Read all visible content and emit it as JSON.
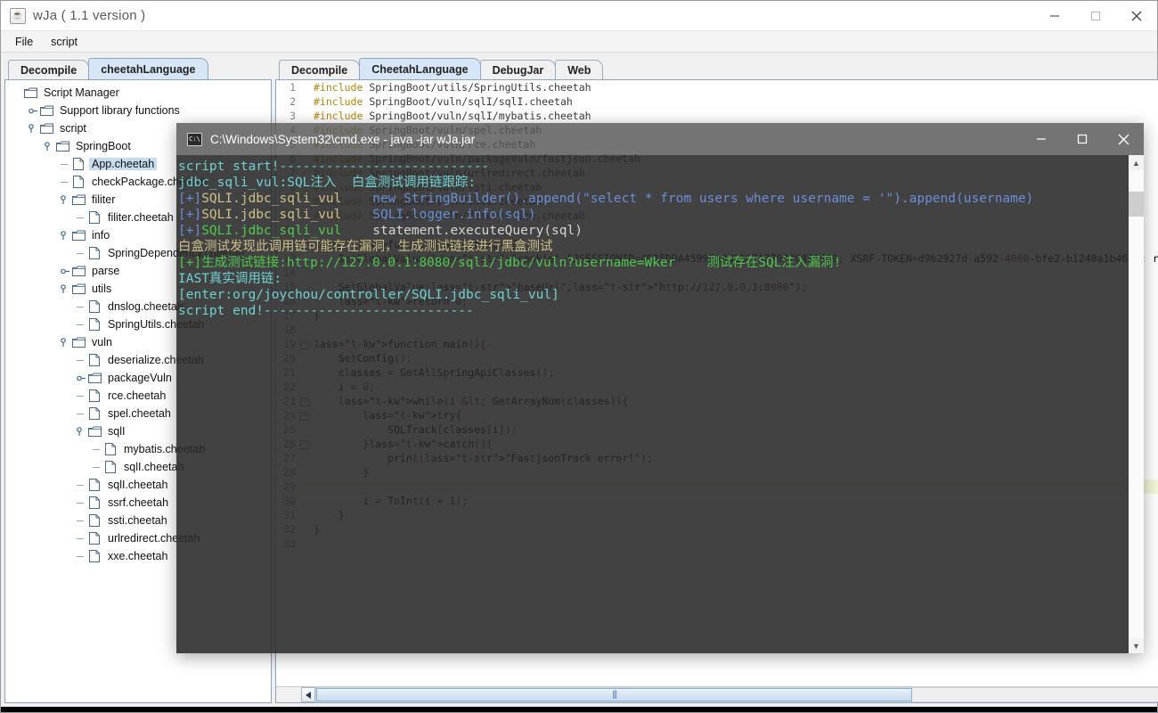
{
  "window": {
    "title": "wJa ( 1.1 version )",
    "icon": "java-icon",
    "minimize": "minimize-icon",
    "maximize": "maximize-icon",
    "close": "close-icon"
  },
  "menu": {
    "items": [
      "File",
      "script"
    ]
  },
  "left": {
    "tabs": [
      {
        "label": "Decompile",
        "selected": false
      },
      {
        "label": "cheetahLanguage",
        "selected": true
      }
    ],
    "tree": [
      {
        "label": "Script Manager",
        "depth": 0,
        "type": "folder",
        "handle": "none",
        "selected": false
      },
      {
        "label": "Support library functions",
        "depth": 1,
        "type": "folder",
        "handle": "collapsed",
        "selected": false
      },
      {
        "label": "script",
        "depth": 1,
        "type": "folder",
        "handle": "expanded",
        "selected": false
      },
      {
        "label": "SpringBoot",
        "depth": 2,
        "type": "folder",
        "handle": "expanded",
        "selected": false
      },
      {
        "label": "App.cheetah",
        "depth": 3,
        "type": "file",
        "handle": "leaf",
        "selected": true
      },
      {
        "label": "checkPackage.cheetah",
        "depth": 3,
        "type": "file",
        "handle": "leaf",
        "selected": false
      },
      {
        "label": "filiter",
        "depth": 3,
        "type": "folder",
        "handle": "expanded",
        "selected": false
      },
      {
        "label": "filiter.cheetah",
        "depth": 4,
        "type": "file",
        "handle": "leaf",
        "selected": false
      },
      {
        "label": "info",
        "depth": 3,
        "type": "folder",
        "handle": "expanded",
        "selected": false
      },
      {
        "label": "SpringDependency.cheetah",
        "depth": 4,
        "type": "file",
        "handle": "leaf",
        "selected": false
      },
      {
        "label": "parse",
        "depth": 3,
        "type": "folder",
        "handle": "collapsed",
        "selected": false
      },
      {
        "label": "utils",
        "depth": 3,
        "type": "folder",
        "handle": "expanded",
        "selected": false
      },
      {
        "label": "dnslog.cheetah",
        "depth": 4,
        "type": "file",
        "handle": "leaf",
        "selected": false
      },
      {
        "label": "SpringUtils.cheetah",
        "depth": 4,
        "type": "file",
        "handle": "leaf",
        "selected": false
      },
      {
        "label": "vuln",
        "depth": 3,
        "type": "folder",
        "handle": "expanded",
        "selected": false
      },
      {
        "label": "deserialize.cheetah",
        "depth": 4,
        "type": "file",
        "handle": "leaf",
        "selected": false
      },
      {
        "label": "packageVuln",
        "depth": 4,
        "type": "folder",
        "handle": "collapsed",
        "selected": false
      },
      {
        "label": "rce.cheetah",
        "depth": 4,
        "type": "file",
        "handle": "leaf",
        "selected": false
      },
      {
        "label": "spel.cheetah",
        "depth": 4,
        "type": "file",
        "handle": "leaf",
        "selected": false
      },
      {
        "label": "sqlI",
        "depth": 4,
        "type": "folder",
        "handle": "expanded",
        "selected": false
      },
      {
        "label": "mybatis.cheetah",
        "depth": 5,
        "type": "file",
        "handle": "leaf",
        "selected": false
      },
      {
        "label": "sqlI.cheetah",
        "depth": 5,
        "type": "file",
        "handle": "leaf",
        "selected": false
      },
      {
        "label": "sqlI.cheetah",
        "depth": 4,
        "type": "file",
        "handle": "leaf",
        "selected": false
      },
      {
        "label": "ssrf.cheetah",
        "depth": 4,
        "type": "file",
        "handle": "leaf",
        "selected": false
      },
      {
        "label": "ssti.cheetah",
        "depth": 4,
        "type": "file",
        "handle": "leaf",
        "selected": false
      },
      {
        "label": "urlredirect.cheetah",
        "depth": 4,
        "type": "file",
        "handle": "leaf",
        "selected": false
      },
      {
        "label": "xxe.cheetah",
        "depth": 4,
        "type": "file",
        "handle": "leaf",
        "selected": false
      }
    ]
  },
  "right": {
    "tabs": [
      {
        "label": "Decompile",
        "selected": false
      },
      {
        "label": "CheetahLanguage",
        "selected": true
      },
      {
        "label": "DebugJar",
        "selected": false
      },
      {
        "label": "Web",
        "selected": false
      }
    ],
    "code": [
      {
        "n": 1,
        "fold": "",
        "text": "#include SpringBoot/utils/SpringUtils.cheetah"
      },
      {
        "n": 2,
        "fold": "",
        "text": "#include SpringBoot/vuln/sqlI/sqlI.cheetah"
      },
      {
        "n": 3,
        "fold": "",
        "text": "#include SpringBoot/vuln/sqlI/mybatis.cheetah"
      },
      {
        "n": 4,
        "fold": "",
        "text": "#include SpringBoot/vuln/spel.cheetah"
      },
      {
        "n": 5,
        "fold": "",
        "text": "#include SpringBoot/vuln/rce.cheetah"
      },
      {
        "n": 6,
        "fold": "",
        "text": "#include SpringBoot/vuln/packageVuln/fastjson.cheetah"
      },
      {
        "n": 7,
        "fold": "",
        "text": "#include SpringBoot/vuln/urlredirect.cheetah"
      },
      {
        "n": 8,
        "fold": "",
        "text": "#include SpringBoot/vuln/ssti.cheetah"
      },
      {
        "n": 9,
        "fold": "",
        "text": "#include SpringBoot/vuln/ssti.cheetah"
      },
      {
        "n": 10,
        "fold": "",
        "text": "#include SpringBoot/vuln/deserialize.cheetah"
      },
      {
        "n": 11,
        "fold": "",
        "text": ""
      },
      {
        "n": 12,
        "fold": "-",
        "text": "function SetConfig(){"
      },
      {
        "n": 13,
        "fold": "",
        "text": "    SetGlobalValue(\"cookie\",\"JSESSIONID=4D15DDA4599EA9B23C7177022C481469; XSRF-TOKEN=d9b2927d-a592-4060-bfe2-b1240a1b46f4; remember-me"
      },
      {
        "n": 14,
        "fold": "",
        "text": ""
      },
      {
        "n": 15,
        "fold": "",
        "text": "    SetGlobalValue(\"baseUrl\",\"http://127.0.0.1:8080\");"
      },
      {
        "n": 16,
        "fold": "",
        "text": "    return 0;"
      },
      {
        "n": 17,
        "fold": "",
        "text": "}"
      },
      {
        "n": 18,
        "fold": "",
        "text": ""
      },
      {
        "n": 19,
        "fold": "-",
        "text": "function main(){"
      },
      {
        "n": 20,
        "fold": "",
        "text": "    SetConfig();"
      },
      {
        "n": 21,
        "fold": "",
        "text": "    classes = GetAllSpringApiClasses();"
      },
      {
        "n": 22,
        "fold": "",
        "text": "    i = 0;"
      },
      {
        "n": 23,
        "fold": "-",
        "text": "    while(i < GetArrayNum(classes)){"
      },
      {
        "n": 24,
        "fold": "-",
        "text": "        try{"
      },
      {
        "n": 25,
        "fold": "",
        "text": "            SQLTrack(classes[i]);"
      },
      {
        "n": 26,
        "fold": "-",
        "text": "        }catch(){"
      },
      {
        "n": 27,
        "fold": "",
        "text": "            print(\"FastjsonTrack error!\");"
      },
      {
        "n": 28,
        "fold": "",
        "text": "        }"
      },
      {
        "n": 29,
        "fold": "",
        "text": "",
        "highlight": true
      },
      {
        "n": 30,
        "fold": "",
        "text": "        i = ToInt(i + 1);"
      },
      {
        "n": 31,
        "fold": "",
        "text": "    }"
      },
      {
        "n": 32,
        "fold": "",
        "text": "}"
      },
      {
        "n": 33,
        "fold": "",
        "text": ""
      }
    ]
  },
  "console": {
    "title": "C:\\Windows\\System32\\cmd.exe - java  -jar wJa.jar",
    "icon": "cmd-icon",
    "minimize": "minimize-icon",
    "maximize": "maximize-icon",
    "close": "close-icon",
    "lines": [
      "script start!---------------------------",
      "jdbc_sqli_vul:SQL注入  白盒测试调用链跟踪:",
      "[+]SQLI.jdbc_sqli_vul    new StringBuilder().append(\"select * from users where username = '\").append(username)",
      "[+]SQLI.jdbc_sqli_vul    SQLI.logger.info(sql)",
      "[+]SQLI.jdbc_sqli_vul    statement.executeQuery(sql)",
      "白盒测试发现此调用链可能存在漏洞，生成测试链接进行黑盒测试",
      "[+]生成测试链接:http://127.0.0.1:8080/sqli/jdbc/vuln?username=Wker    测试存在SQL注入漏洞!",
      "IAST真实调用链:",
      "[enter:org/joychou/controller/SQLI.jdbc_sqli_vul]",
      "script end!---------------------------"
    ]
  },
  "colors": {
    "tab_selected": "#d6e6f7",
    "tree_selection": "#c6dcf0",
    "console_bg": "#282828",
    "console_title_bg": "#565656",
    "console_cyan": "#6fd2d2",
    "console_green": "#4ec94e",
    "console_yellow": "#c8c87a",
    "console_blue": "#6a8fd8",
    "editor_highlight": "#f6f6d8"
  }
}
